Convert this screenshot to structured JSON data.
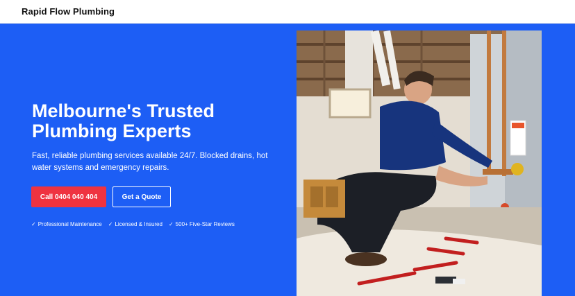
{
  "header": {
    "brand": "Rapid Flow Plumbing"
  },
  "hero": {
    "headline_line1": "Melbourne's Trusted",
    "headline_line2": "Plumbing Experts",
    "subtext": "Fast, reliable plumbing services available 24/7. Blocked drains, hot water systems and emergency repairs.",
    "call_button": "Call 0404 040 404",
    "quote_button": "Get a Quote",
    "features": [
      {
        "check": "✓",
        "label": "Professional Maintenance"
      },
      {
        "check": "✓",
        "label": "Licensed & Insured"
      },
      {
        "check": "✓",
        "label": "500+ Five-Star Reviews"
      }
    ]
  },
  "colors": {
    "hero_bg": "#1d5ef5",
    "call_button_bg": "#ef3340",
    "text": "#ffffff"
  },
  "image": {
    "subject": "plumber-repairing-hot-water-system-icon"
  }
}
